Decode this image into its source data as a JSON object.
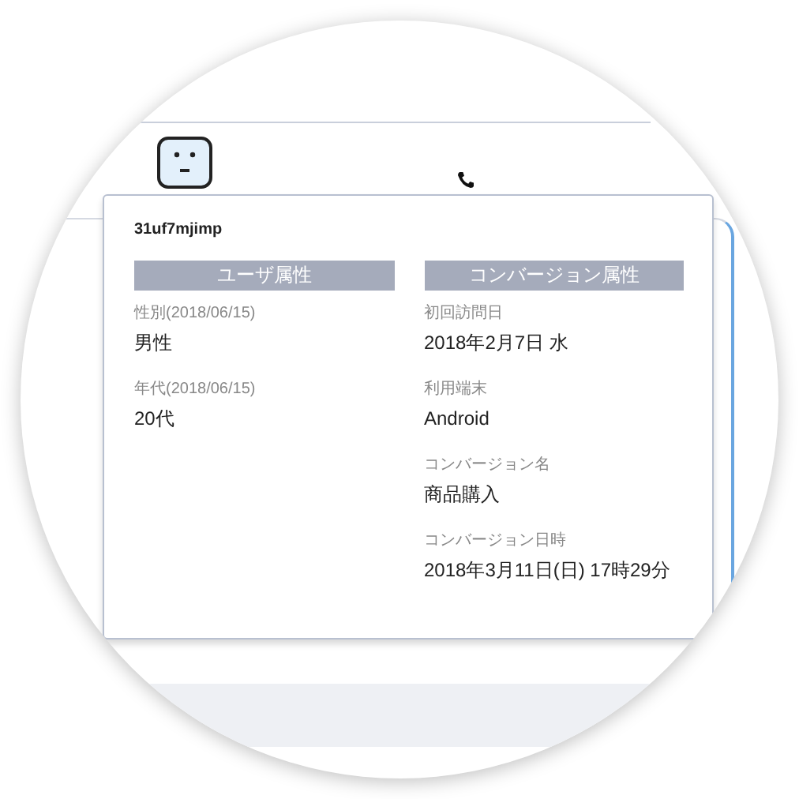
{
  "popover": {
    "user_id": "31uf7mjimp",
    "sections": [
      {
        "title": "ユーザ属性",
        "fields": [
          {
            "label": "性別(2018/06/15)",
            "value": "男性"
          },
          {
            "label": "年代(2018/06/15)",
            "value": "20代"
          }
        ]
      },
      {
        "title": "コンバージョン属性",
        "fields": [
          {
            "label": "初回訪問日",
            "value": "2018年2月7日 水"
          },
          {
            "label": "利用端末",
            "value": "Android"
          },
          {
            "label": "コンバージョン名",
            "value": "商品購入"
          },
          {
            "label": "コンバージョン日時",
            "value": "2018年3月11日(日) 17時29分"
          }
        ]
      }
    ]
  }
}
